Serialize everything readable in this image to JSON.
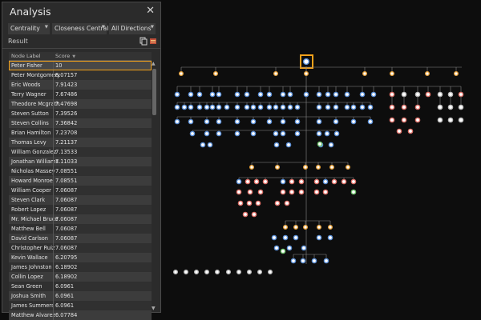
{
  "panel": {
    "title": "Analysis",
    "close_glyph": "✕",
    "dropdowns": [
      "Centrality",
      "Closeness Centrality",
      "All Directions"
    ],
    "result_label": "Result",
    "icons": [
      "copy-icon",
      "export-icon"
    ]
  },
  "table": {
    "columns": [
      "Node Label",
      "Score"
    ],
    "rows": [
      {
        "label": "Peter Fisher",
        "score": "10"
      },
      {
        "label": "Peter Montgomery",
        "score": "8.07157"
      },
      {
        "label": "Eric Woods",
        "score": "7.91423"
      },
      {
        "label": "Terry Wagner",
        "score": "7.67486"
      },
      {
        "label": "Theodore Mcgrath",
        "score": "7.47698"
      },
      {
        "label": "Steven Sutton",
        "score": "7.39526"
      },
      {
        "label": "Steven Collins",
        "score": "7.36842"
      },
      {
        "label": "Brian Hamilton",
        "score": "7.23708"
      },
      {
        "label": "Thomas Levy",
        "score": "7.21137"
      },
      {
        "label": "William Gonzalez",
        "score": "7.13533"
      },
      {
        "label": "Jonathan Williams",
        "score": "7.11033"
      },
      {
        "label": "Nicholas Massey",
        "score": "7.08551"
      },
      {
        "label": "Howard Monroe",
        "score": "7.08551"
      },
      {
        "label": "William Cooper",
        "score": "7.06087"
      },
      {
        "label": "Steven Clark",
        "score": "7.06087"
      },
      {
        "label": "Robert Lopez",
        "score": "7.06087"
      },
      {
        "label": "Mr. Michael Bruce",
        "score": "7.06087"
      },
      {
        "label": "Matthew Bell",
        "score": "7.06087"
      },
      {
        "label": "David Carlson",
        "score": "7.06087"
      },
      {
        "label": "Christopher Ruiz",
        "score": "7.06087"
      },
      {
        "label": "Kevin Wallace",
        "score": "6.20795"
      },
      {
        "label": "James Johnston",
        "score": "6.18902"
      },
      {
        "label": "Collin Lopez",
        "score": "6.18902"
      },
      {
        "label": "Sean Green",
        "score": "6.0961"
      },
      {
        "label": "Joshua Smith",
        "score": "6.0961"
      },
      {
        "label": "James Summers",
        "score": "6.0961"
      },
      {
        "label": "Matthew Alvarez",
        "score": "6.07784"
      }
    ],
    "selected_index": 0
  },
  "colors": {
    "highlight": "#f2a11a",
    "node_blue": "#5b8fd6",
    "node_red": "#e0726a",
    "node_orange": "#e8a23a",
    "node_green": "#6cc06a",
    "node_gray": "#bbbbbb",
    "edge": "#8a8a8a"
  }
}
